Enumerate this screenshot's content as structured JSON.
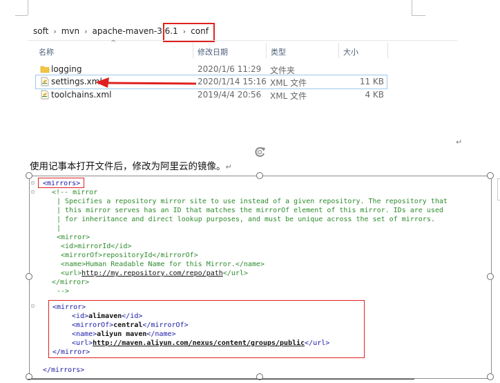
{
  "breadcrumb": [
    "soft",
    "mvn",
    "apache-maven-3.6.1",
    "conf"
  ],
  "columns": {
    "name": "名称",
    "modified": "修改日期",
    "type": "类型",
    "size": "大小"
  },
  "files": [
    {
      "name": "logging",
      "modified": "2020/1/6 11:29",
      "type": "文件夹",
      "size": "",
      "icon": "folder-icon"
    },
    {
      "name": "settings.xml",
      "modified": "2020/1/14 15:16",
      "type": "XML 文件",
      "size": "11 KB",
      "icon": "xml-file-icon"
    },
    {
      "name": "toolchains.xml",
      "modified": "2019/4/4 20:56",
      "type": "XML 文件",
      "size": "4 KB",
      "icon": "xml-file-icon"
    }
  ],
  "paragraph": "使用记事本打开文件后，修改为阿里云的镜像。",
  "code": {
    "mirrors_open": "<mirrors>",
    "comment_open": "<!-- mirror",
    "comment_lines": [
      "| Specifies a repository mirror site to use instead of a given repository. The repository that",
      "| this mirror serves has an ID that matches the mirrorOf element of this mirror. IDs are used",
      "| for inheritance and direct lookup purposes, and must be unique across the set of mirrors.",
      "|"
    ],
    "example": {
      "open": "<mirror>",
      "id_open": "<id>",
      "id": "mirrorId",
      "id_close": "</id>",
      "of_open": "<mirrorOf>",
      "of": "repositoryId",
      "of_close": "</mirrorOf>",
      "name_open": "<name>",
      "name": "Human Readable Name for this Mirror.",
      "name_close": "</name>",
      "url_open": "<url>",
      "url": "http://my.repository.com/repo/path",
      "url_close": "</url>",
      "close": "</mirror>"
    },
    "comment_close": "-->",
    "aliyun": {
      "open": "<mirror>",
      "id_open": "<id>",
      "id": "alimaven",
      "id_close": "</id>",
      "of_open": "<mirrorOf>",
      "of": "central",
      "of_close": "</mirrorOf>",
      "name_open": "<name>",
      "name": "aliyun maven",
      "name_close": "</name>",
      "url_open": "<url>",
      "url": "http://maven.aliyun.com/nexus/content/groups/public",
      "url_close": "</url>",
      "close": "</mirror>"
    },
    "mirrors_close": "</mirrors>"
  },
  "colors": {
    "highlight": "#e02020",
    "tag": "#1a1aa6",
    "comment": "#2e8b2e"
  }
}
